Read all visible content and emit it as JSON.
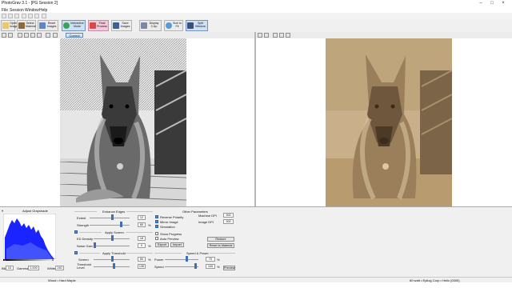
{
  "window": {
    "title": "PhotoGrav 3.1 - [PG Session 2]"
  },
  "menu": [
    "File",
    "Session",
    "Window",
    "Help"
  ],
  "toolbar": {
    "open_image": "Open Image",
    "select_material": "Select Material",
    "reset_images": "Reset Images",
    "interactive_mode": "Interactive Mode",
    "final_process": "Final Process",
    "save_images": "Save Images",
    "display_2up": "Display 2-Up",
    "size_to_fit": "Size to Fit",
    "split_window": "Split Window"
  },
  "viewbar": {
    "correct_label": "Correct"
  },
  "adjust_grayshade": {
    "title": "Adjust Grayshade",
    "black_label": "Blk",
    "black_value": "10",
    "gamma_label": "Gamma",
    "gamma_value": "1.000",
    "white_label": "White",
    "white_value": "240"
  },
  "enhance_edges": {
    "title": "Enhance Edges",
    "extent_label": "Extent",
    "extent_value": "12",
    "extent_unit": "",
    "strength_label": "Strength",
    "strength_value": "80",
    "strength_unit": "%"
  },
  "apply_screen": {
    "title": "Apply Screen",
    "density_label": "ED Density",
    "density_value": "18",
    "noise_label": "Noise Gain",
    "noise_value": "0",
    "noise_unit": "%"
  },
  "apply_threshold": {
    "title": "Apply Threshold",
    "screen_label": "Screen",
    "screen_value": "50",
    "screen_unit": "%",
    "threshold_label": "Threshold Level",
    "threshold_value": "135"
  },
  "other_parameters": {
    "title": "Other Parameters",
    "reverse_polarity": "Reverse Polarity",
    "mirror_image": "Mirror Image",
    "simulation": "Simulation",
    "show_progress": "Show Progress",
    "auto_preview": "Auto Preview",
    "export": "Export",
    "import": "Import",
    "machine_dpi_label": "Machine DPI",
    "machine_dpi_value": "300",
    "image_dpi_label": "Image DPI",
    "image_dpi_value": "300",
    "restore": "Restore",
    "reset_to_material": "Reset to Material"
  },
  "speed_power": {
    "title": "Speed & Power",
    "power_label": "Power",
    "power_value": "70",
    "power_unit": "%",
    "speed_label": "Speed",
    "speed_value": "100",
    "speed_unit": "%",
    "preview": "Preview"
  },
  "status": {
    "material": "Wood • Hard Maple",
    "machine": "60 watt • Epilog Corp • Helix (0000)"
  },
  "colors": {
    "histogram": "#1a24ff",
    "pink_button": "#f3c9d9",
    "sepia": "#c6ab80"
  }
}
